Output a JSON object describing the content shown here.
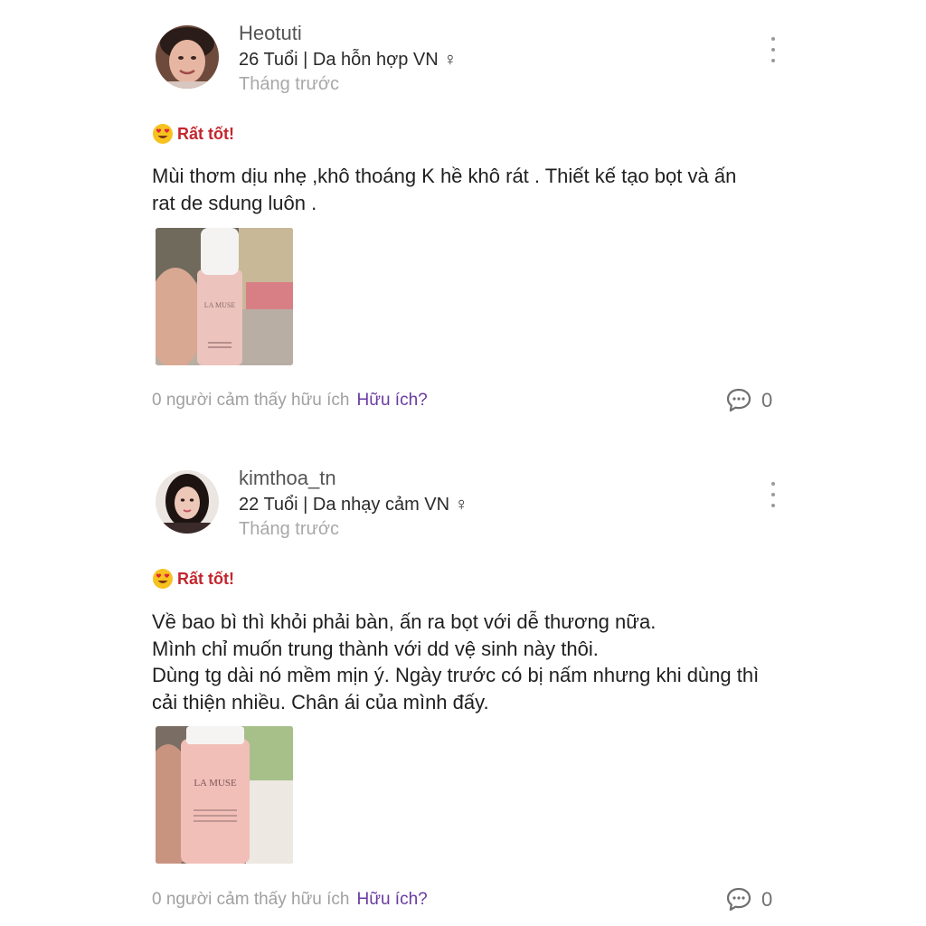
{
  "reviews": [
    {
      "username": "Heotuti",
      "profile": "26 Tuổi | Da hỗn hợp VN ♀",
      "time": "Tháng trước",
      "rating_label": "Rất tốt!",
      "body": "Mùi thơm dịu nhẹ ,khô thoáng K hề khô rát  . Thiết kế tạo bọt và ấn\nrat de sdung luôn .",
      "helpful_count_text": "0 người cảm thấy hữu ích",
      "helpful_button": "Hữu ích?",
      "comment_count": "0",
      "photo_brand_text": "LA MUSE"
    },
    {
      "username": "kimthoa_tn",
      "profile": "22 Tuổi | Da nhạy cảm VN ♀",
      "time": "Tháng trước",
      "rating_label": "Rất tốt!",
      "body": "Về bao bì thì khỏi phải bàn, ấn ra bọt với dễ thương nữa.\nMình chỉ muốn trung thành với dd vệ sinh này thôi.\nDùng tg dài nó mềm mịn ý. Ngày trước có bị nấm nhưng khi dùng thì\ncải thiện nhiều. Chân ái của mình đấy.",
      "helpful_count_text": "0 người cảm thấy hữu ích",
      "helpful_button": "Hữu ích?",
      "comment_count": "0",
      "photo_brand_text": "LA MUSE"
    }
  ],
  "icons": {
    "more": "more-vertical-icon",
    "comment": "comment-bubble-icon",
    "rating": "heart-eyes-emoji-icon"
  },
  "colors": {
    "rating": "#c4262e",
    "helpful_button": "#6a3aa0",
    "muted": "#a0a0a0"
  }
}
